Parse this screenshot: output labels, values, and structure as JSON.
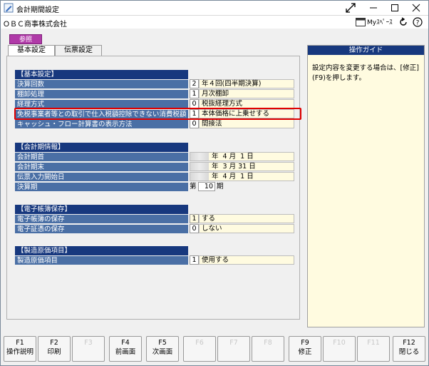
{
  "window": {
    "title": "会計期間設定"
  },
  "header": {
    "company": "ＯＢＣ商事株式会社",
    "myspace_label": "Myｽﾍﾟｰｽ"
  },
  "badge": "参照",
  "tabs": [
    {
      "label": "基本設定"
    },
    {
      "label": "伝票設定"
    }
  ],
  "groups": {
    "basic": {
      "title": "【基本設定】",
      "rows": [
        {
          "label": "決算回数",
          "code": "2",
          "value": "年４回(四半期決算)"
        },
        {
          "label": "棚卸処理",
          "code": "1",
          "value": "月次棚卸"
        },
        {
          "label": "経理方式",
          "code": "0",
          "value": "税抜経理方式"
        },
        {
          "label": "免税事業者等との取引で仕入税額控除できない消費税額",
          "code": "1",
          "value": "本体価格に上乗せする"
        },
        {
          "label": "キャッシュ・フロー計算書の表示方法",
          "code": "0",
          "value": "間接法"
        }
      ]
    },
    "period": {
      "title": "【会計期情報】",
      "rows": [
        {
          "label": "会計期首",
          "value": "年  4 月  1 日"
        },
        {
          "label": "会計期末",
          "value": "年  3 月 31 日"
        },
        {
          "label": "伝票入力開始日",
          "value": "年  4 月  1 日"
        }
      ],
      "closing": {
        "label": "決算期",
        "prefix": "第",
        "value": "10",
        "suffix": "期"
      }
    },
    "ebook": {
      "title": "【電子帳簿保存】",
      "rows": [
        {
          "label": "電子帳簿の保存",
          "code": "1",
          "value": "する"
        },
        {
          "label": "電子証憑の保存",
          "code": "0",
          "value": "しない"
        }
      ]
    },
    "cost": {
      "title": "【製造原価項目】",
      "rows": [
        {
          "label": "製造原価項目",
          "code": "1",
          "value": "使用する"
        }
      ]
    }
  },
  "guide": {
    "title": "操作ガイド",
    "text": "設定内容を変更する場合は、[修正](F9)を押します。"
  },
  "fkeys": [
    {
      "key": "F1",
      "label": "操作説明",
      "enabled": true
    },
    {
      "key": "F2",
      "label": "印刷",
      "enabled": true
    },
    {
      "key": "F3",
      "label": "",
      "enabled": false
    },
    {
      "key": "F4",
      "label": "前画面",
      "enabled": true
    },
    {
      "key": "F5",
      "label": "次画面",
      "enabled": true
    },
    {
      "key": "F6",
      "label": "",
      "enabled": false
    },
    {
      "key": "F7",
      "label": "",
      "enabled": false
    },
    {
      "key": "F8",
      "label": "",
      "enabled": false
    },
    {
      "key": "F9",
      "label": "修正",
      "enabled": true
    },
    {
      "key": "F10",
      "label": "",
      "enabled": false
    },
    {
      "key": "F11",
      "label": "",
      "enabled": false
    },
    {
      "key": "F12",
      "label": "閉じる",
      "enabled": true
    }
  ],
  "colors": {
    "header_navy": "#17387e",
    "label_blue": "#4a6fa5",
    "value_yellow": "#fffbe0",
    "badge_purple": "#b03aa8",
    "highlight_red": "#e00000"
  }
}
